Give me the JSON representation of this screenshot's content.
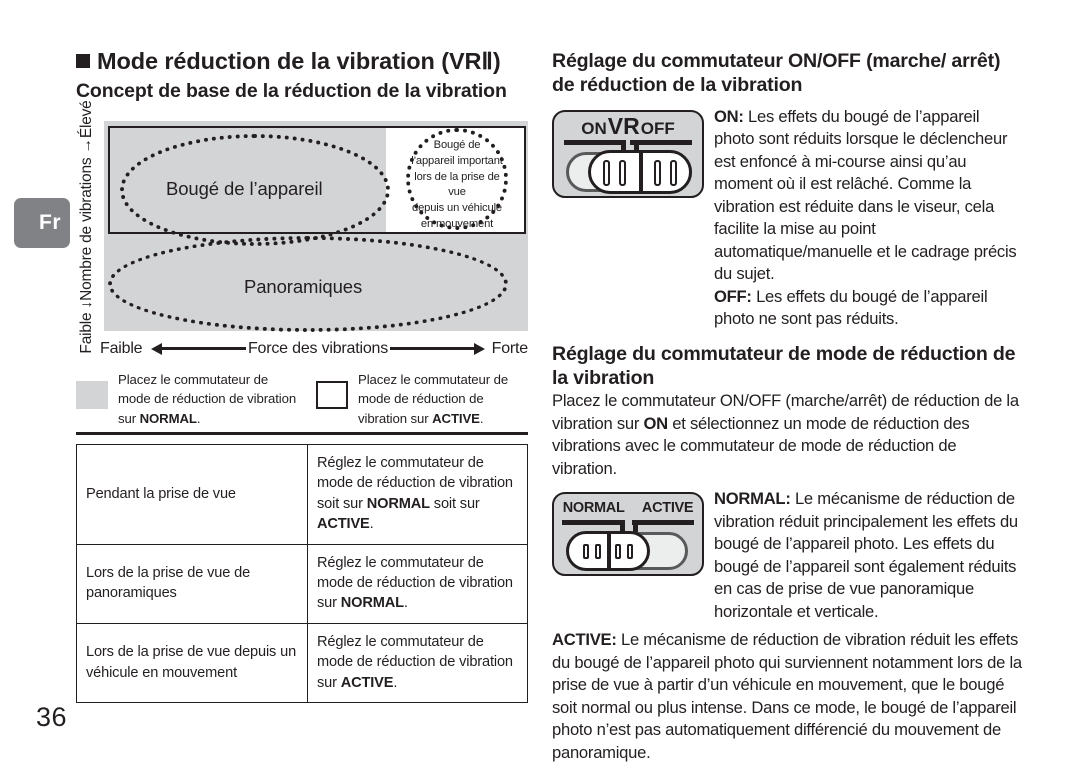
{
  "page": {
    "number": "36",
    "language_tab": "Fr"
  },
  "left": {
    "heading_main": "Mode réduction de la vibration (VRⅡ)",
    "heading_sub": "Concept de base de la réduction de la vibration",
    "diagram": {
      "y_axis_label": "Faible ↓Nombre de vibrations →Élevé",
      "y_axis_low": "Faible",
      "y_axis_name": "Nombre de vibrations",
      "y_axis_high": "Élevé",
      "x_axis_low": "Faible",
      "x_axis_name": "Force des vibrations",
      "x_axis_high": "Forte",
      "ellipse_camera_shake": "Bougé de l’appareil",
      "ellipse_panning": "Panoramiques",
      "circle_note": "Bougé de l’appareil important lors de la prise de vue depuis un véhicule en mouvement",
      "circle_note_lines": [
        "Bougé de",
        "l’appareil important",
        "lors de la prise de vue",
        "depuis un véhicule",
        "en mouvement"
      ]
    },
    "legend": [
      {
        "swatch": "gray",
        "text_prefix": "Placez le commutateur de mode de réduction de vibration sur ",
        "mode": "NORMAL",
        "text_suffix": "."
      },
      {
        "swatch": "white",
        "text_prefix": "Placez le commutateur de mode de réduction de vibration sur ",
        "mode": "ACTIVE",
        "text_suffix": "."
      }
    ],
    "table": {
      "rows": [
        {
          "situation": "Pendant la prise de vue",
          "setting_prefix": "Réglez le commutateur de mode de réduction de vibration soit sur ",
          "setting_mode1": "NORMAL",
          "setting_middle": " soit sur ",
          "setting_mode2": "ACTIVE",
          "setting_suffix": "."
        },
        {
          "situation": "Lors de la prise de vue de panoramiques",
          "setting_prefix": "Réglez le commutateur de mode de réduction de vibration sur ",
          "setting_mode1": "NORMAL",
          "setting_middle": "",
          "setting_mode2": "",
          "setting_suffix": "."
        },
        {
          "situation": "Lors de la prise de vue depuis un véhicule en mouvement",
          "setting_prefix": "Réglez le commutateur de mode de réduction de vibration sur ",
          "setting_mode1": "ACTIVE",
          "setting_middle": "",
          "setting_mode2": "",
          "setting_suffix": "."
        }
      ]
    }
  },
  "right": {
    "heading_onoff": "Réglage du commutateur ON/OFF (marche/ arrêt) de réduction de la vibration",
    "switch_onoff": {
      "label_on": "ON",
      "label_vr": "VR",
      "label_off": "OFF",
      "position": "off"
    },
    "on_label": "ON:",
    "on_text": " Les effets du bougé de l’appareil photo sont réduits lorsque le déclencheur est enfoncé à mi-course ainsi qu’au moment où il est relâché. Comme la vibration est réduite dans le viseur, cela facilite la mise au point automatique/manuelle et le cadrage précis du sujet.",
    "off_label": "OFF:",
    "off_text": " Les effets du bougé de l’appareil photo ne sont pas réduits.",
    "heading_mode": "Réglage du commutateur de mode de réduction de la vibration",
    "mode_intro_part1": "Placez le commutateur ON/OFF (marche/arrêt) de réduction de la vibration sur ",
    "mode_intro_bold": "ON",
    "mode_intro_part2": " et sélectionnez un mode de réduction des vibrations avec le commutateur de mode de réduction de vibration.",
    "switch_mode": {
      "label_normal": "NORMAL",
      "label_active": "ACTIVE",
      "position": "normal"
    },
    "normal_label": "NORMAL:",
    "normal_text": " Le mécanisme de réduction de vibration réduit principalement les effets du bougé de l’appareil photo. Les effets du bougé de l’appareil sont également réduits en cas de prise de vue panoramique horizontale et verticale.",
    "active_label": "ACTIVE:",
    "active_text": " Le mécanisme de réduction de vibration réduit les effets du bougé de l’appareil photo qui surviennent notamment lors de la prise de vue à partir d’un véhicule en mouvement, que le bougé soit normal ou plus intense. Dans ce mode, le bougé de l’appareil photo n’est pas automatiquement différencié du mouvement de panoramique."
  },
  "colors": {
    "ink": "#231f20",
    "gray_fill": "#d3d4d6",
    "tab_gray": "#808285"
  }
}
